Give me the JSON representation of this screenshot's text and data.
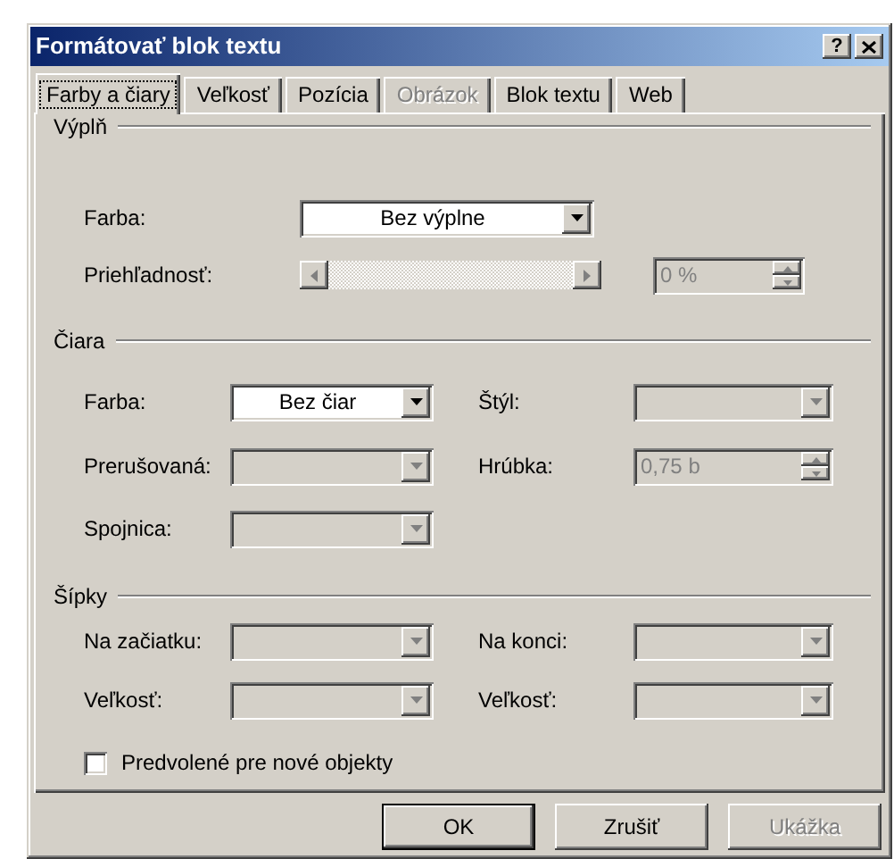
{
  "window": {
    "title": "Formátovať blok textu",
    "title_buttons": [
      {
        "kind": "help",
        "label": "?"
      },
      {
        "kind": "close"
      }
    ]
  },
  "tabs": [
    {
      "label": "Farby a čiary",
      "selected": true,
      "disabled": false
    },
    {
      "label": "Veľkosť",
      "selected": false,
      "disabled": false
    },
    {
      "label": "Pozícia",
      "selected": false,
      "disabled": false
    },
    {
      "label": "Obrázok",
      "selected": false,
      "disabled": true
    },
    {
      "label": "Blok textu",
      "selected": false,
      "disabled": false
    },
    {
      "label": "Web",
      "selected": false,
      "disabled": false
    }
  ],
  "sections": [
    {
      "title": "Výplň",
      "kind": "single",
      "rows": [
        {
          "fields": [
            {
              "kind": "select",
              "label": "Farba:",
              "value": "Bez výplne",
              "disabled": false
            }
          ]
        },
        {
          "fields": [
            {
              "kind": "slider",
              "label": "Priehľadnosť:",
              "disabled": true
            },
            {
              "kind": "spinner",
              "value": "0 %",
              "disabled": true
            }
          ]
        }
      ]
    },
    {
      "title": "Čiara",
      "kind": "pairs",
      "rows": [
        {
          "fields": [
            {
              "kind": "select",
              "label": "Farba:",
              "value": "Bez čiar",
              "disabled": false
            },
            {
              "kind": "select",
              "label": "Štýl:",
              "disabled": true
            }
          ]
        },
        {
          "fields": [
            {
              "kind": "select",
              "label": "Prerušovaná:",
              "disabled": true
            },
            {
              "kind": "spinner",
              "label": "Hrúbka:",
              "value": "0,75 b",
              "disabled": true
            }
          ]
        },
        {
          "fields": [
            {
              "kind": "select",
              "label": "Spojnica:",
              "disabled": true
            }
          ]
        }
      ]
    },
    {
      "title": "Šípky",
      "kind": "pairs",
      "rows": [
        {
          "fields": [
            {
              "kind": "select",
              "label": "Na začiatku:",
              "disabled": true
            },
            {
              "kind": "select",
              "label": "Na konci:",
              "disabled": true
            }
          ]
        },
        {
          "fields": [
            {
              "kind": "select",
              "label": "Veľkosť:",
              "disabled": true
            },
            {
              "kind": "select",
              "label": "Veľkosť:",
              "disabled": true
            }
          ]
        }
      ]
    }
  ],
  "checkbox": {
    "label": "Predvolené pre nové objekty",
    "checked": false
  },
  "buttons": [
    {
      "label": "OK",
      "kind": "default",
      "disabled": false
    },
    {
      "label": "Zrušiť",
      "kind": "normal",
      "disabled": false
    },
    {
      "label": "Ukážka",
      "kind": "normal",
      "disabled": true
    }
  ]
}
